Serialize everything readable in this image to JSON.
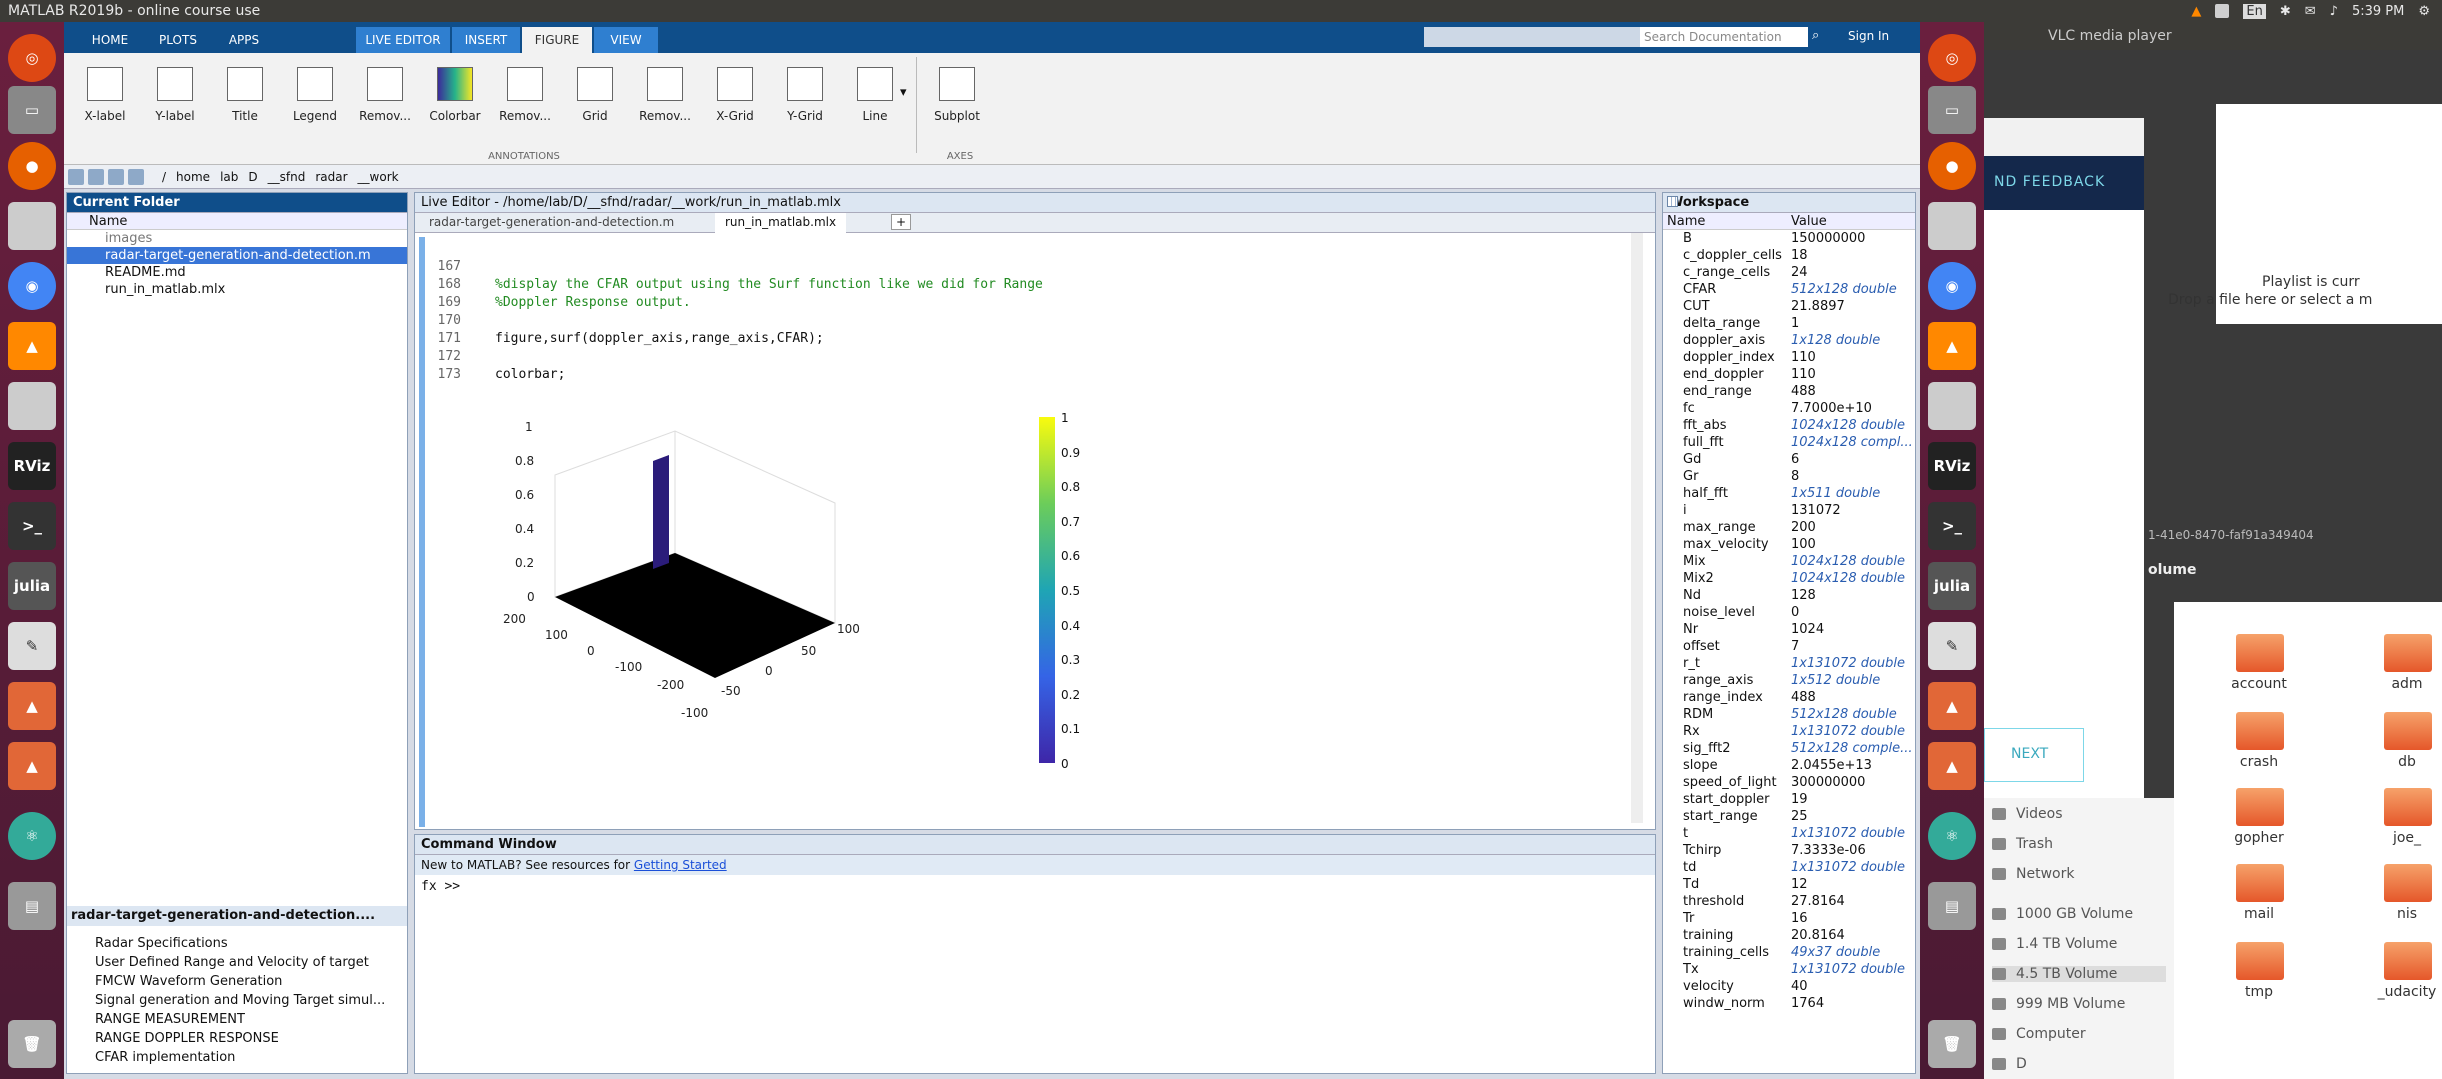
{
  "topbar": {
    "title": "MATLAB R2019b - online course use",
    "time": "5:39 PM",
    "lang": "En"
  },
  "tabs": [
    "HOME",
    "PLOTS",
    "APPS",
    "LIVE EDITOR",
    "INSERT",
    "FIGURE",
    "VIEW"
  ],
  "search": {
    "placeholder": "Search Documentation"
  },
  "signin": "Sign In",
  "ribbon": {
    "buttons": [
      "X-label",
      "Y-label",
      "Title",
      "Legend",
      "Remov...",
      "Colorbar",
      "Remov...",
      "Grid",
      "Remov...",
      "X-Grid",
      "Y-Grid",
      "Line"
    ],
    "subplot": "Subplot",
    "group_annotations": "ANNOTATIONS",
    "group_axes": "AXES"
  },
  "path": [
    "/",
    "home",
    "lab",
    "D",
    "__sfnd",
    "radar",
    "__work"
  ],
  "current_folder": {
    "title": "Current Folder",
    "col": "Name",
    "items": [
      "images",
      "radar-target-generation-and-detection.m",
      "README.md",
      "run_in_matlab.mlx"
    ]
  },
  "details": {
    "title": "radar-target-generation-and-detection....",
    "items": [
      "Radar Specifications",
      "User Defined Range and Velocity of target",
      "FMCW Waveform Generation",
      "Signal generation and Moving Target simul...",
      "RANGE MEASUREMENT",
      "RANGE DOPPLER RESPONSE",
      "CFAR implementation"
    ]
  },
  "editor": {
    "title": "Live Editor - /home/lab/D/__sfnd/radar/__work/run_in_matlab.mlx",
    "tabs": [
      "radar-target-generation-and-detection.m",
      "run_in_matlab.mlx",
      "+"
    ],
    "lines": [
      {
        "n": "167",
        "t": ""
      },
      {
        "n": "168",
        "t": "%display the CFAR output using the Surf function like we did for Range"
      },
      {
        "n": "169",
        "t": "%Doppler Response output."
      },
      {
        "n": "170",
        "t": ""
      },
      {
        "n": "171",
        "t": "figure,surf(doppler_axis,range_axis,CFAR);"
      },
      {
        "n": "172",
        "t": ""
      },
      {
        "n": "173",
        "t": "colorbar;"
      }
    ]
  },
  "plot": {
    "zticks": [
      "0",
      "0.2",
      "0.4",
      "0.6",
      "0.8",
      "1"
    ],
    "xticks": [
      "200",
      "100",
      "0",
      "-100",
      "-200"
    ],
    "yticks": [
      "100",
      "50",
      "0",
      "-50",
      "-100"
    ],
    "cbticks": [
      "0",
      "0.1",
      "0.2",
      "0.3",
      "0.4",
      "0.5",
      "0.6",
      "0.7",
      "0.8",
      "0.9",
      "1"
    ]
  },
  "command": {
    "title": "Command Window",
    "banner": "New to MATLAB? See resources for ",
    "link": "Getting Started",
    "prompt": "fx >>"
  },
  "workspace": {
    "title": "Workspace",
    "cols": [
      "Name",
      "Value"
    ],
    "vars": [
      [
        "B",
        "150000000",
        0
      ],
      [
        "c_doppler_cells",
        "18",
        0
      ],
      [
        "c_range_cells",
        "24",
        0
      ],
      [
        "CFAR",
        "512x128 double",
        1
      ],
      [
        "CUT",
        "21.8897",
        0
      ],
      [
        "delta_range",
        "1",
        0
      ],
      [
        "doppler_axis",
        "1x128 double",
        1
      ],
      [
        "doppler_index",
        "110",
        0
      ],
      [
        "end_doppler",
        "110",
        0
      ],
      [
        "end_range",
        "488",
        0
      ],
      [
        "fc",
        "7.7000e+10",
        0
      ],
      [
        "fft_abs",
        "1024x128 double",
        1
      ],
      [
        "full_fft",
        "1024x128 compl...",
        1
      ],
      [
        "Gd",
        "6",
        0
      ],
      [
        "Gr",
        "8",
        0
      ],
      [
        "half_fft",
        "1x511 double",
        1
      ],
      [
        "i",
        "131072",
        0
      ],
      [
        "max_range",
        "200",
        0
      ],
      [
        "max_velocity",
        "100",
        0
      ],
      [
        "Mix",
        "1024x128 double",
        1
      ],
      [
        "Mix2",
        "1024x128 double",
        1
      ],
      [
        "Nd",
        "128",
        0
      ],
      [
        "noise_level",
        "0",
        0
      ],
      [
        "Nr",
        "1024",
        0
      ],
      [
        "offset",
        "7",
        0
      ],
      [
        "r_t",
        "1x131072 double",
        1
      ],
      [
        "range_axis",
        "1x512 double",
        1
      ],
      [
        "range_index",
        "488",
        0
      ],
      [
        "RDM",
        "512x128 double",
        1
      ],
      [
        "Rx",
        "1x131072 double",
        1
      ],
      [
        "sig_fft2",
        "512x128 comple...",
        1
      ],
      [
        "slope",
        "2.0455e+13",
        0
      ],
      [
        "speed_of_light",
        "300000000",
        0
      ],
      [
        "start_doppler",
        "19",
        0
      ],
      [
        "start_range",
        "25",
        0
      ],
      [
        "t",
        "1x131072 double",
        1
      ],
      [
        "Tchirp",
        "7.3333e-06",
        0
      ],
      [
        "td",
        "1x131072 double",
        1
      ],
      [
        "Td",
        "12",
        0
      ],
      [
        "threshold",
        "27.8164",
        0
      ],
      [
        "Tr",
        "16",
        0
      ],
      [
        "training",
        "20.8164",
        0
      ],
      [
        "training_cells",
        "49x37 double",
        1
      ],
      [
        "Tx",
        "1x131072 double",
        1
      ],
      [
        "velocity",
        "40",
        0
      ],
      [
        "windw_norm",
        "1764",
        0
      ]
    ]
  },
  "vlc": {
    "title": "VLC media player",
    "feedback": "ND FEEDBACK",
    "playlist": "Playlist is curr",
    "drop": "Drop a file here or select a m",
    "next": "NEXT",
    "uuid": "1-41e0-8470-faf91a349404",
    "volume": "olume"
  },
  "files": {
    "sidebar": [
      "Videos",
      "Trash",
      "Network",
      "1000 GB Volume",
      "1.4 TB Volume",
      "4.5 TB Volume",
      "999 MB Volume",
      "Computer",
      "D"
    ],
    "folders": [
      "account",
      "adm",
      "crash",
      "db",
      "gopher",
      "joe_",
      "mail",
      "nis",
      "tmp",
      "_udacity"
    ]
  },
  "launcher": [
    "RViz",
    "julia"
  ]
}
